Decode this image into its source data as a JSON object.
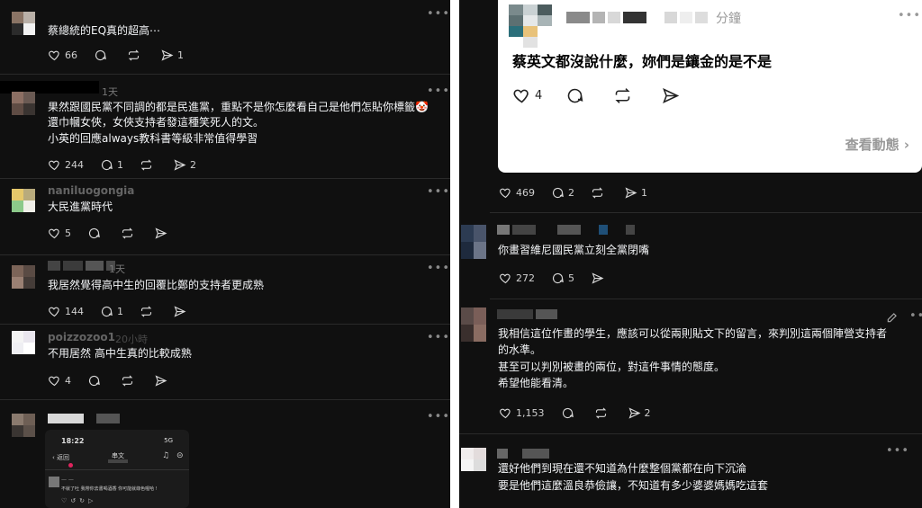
{
  "left_column": {
    "posts": [
      {
        "time": "",
        "lines": [
          "蔡總統的EQ真的超高⋯"
        ],
        "likes": "66",
        "replies": "",
        "shares": ""
      },
      {
        "time": "1天",
        "lines": [
          "果然跟國民黨不同調的都是民進黨，重點不是你怎麼看自己是他們怎貼你標籤🤡",
          "還巾幗女俠，女俠支持者發這種笑死人的文。",
          "小英的回應always教科書等級非常值得學習"
        ],
        "likes": "244",
        "replies": "1",
        "shares": "2"
      },
      {
        "time": "",
        "name_fragment": "naniluogongia",
        "lines": [
          "大民進黨時代"
        ],
        "likes": "5",
        "replies": "",
        "shares": ""
      },
      {
        "time": "1天",
        "lines": [
          "我居然覺得高中生的回覆比鄭的支持者更成熟"
        ],
        "likes": "144",
        "replies": "1",
        "shares": ""
      },
      {
        "time": "20小時",
        "name_fragment": "poizzozoo1",
        "lines": [
          "不用居然 高中生真的比較成熟"
        ],
        "likes": "4",
        "replies": "",
        "shares": ""
      }
    ],
    "phone": {
      "clock": "18:22",
      "signal": "5G",
      "back": "返回",
      "title": "串文",
      "comment": "不就了吐 我帶你去書喝酒香 你可能就綠色喔哈 !"
    }
  },
  "right_column": {
    "card": {
      "time": "分鐘",
      "text": "蔡英文都沒說什麼，妳們是鑲金的是不是",
      "likes": "4",
      "link": "查看動態"
    },
    "stats_under_card": {
      "likes": "469",
      "replies": "2",
      "shares": "1"
    },
    "posts": [
      {
        "lines": [
          "你畫習維尼國民黨立刻全黨閉嘴"
        ],
        "likes": "272",
        "replies": "5",
        "shares": ""
      },
      {
        "lines": [
          "我相信這位作畫的學生，應該可以從兩則貼文下的留言，來判別這兩個陣營支持者",
          "的水準。",
          "甚至可以判別被畫的兩位，對這件事情的態度。",
          "希望他能看清。"
        ],
        "likes": "1,153",
        "replies": "",
        "shares": "2"
      },
      {
        "lines": [
          "還好他們到現在還不知道為什麼整個黨都在向下沉淪",
          "要是他們這麼溫良恭儉讓，不知道有多少婆婆媽媽吃這套"
        ],
        "likes": "",
        "replies": "",
        "shares": ""
      }
    ]
  },
  "icons": {
    "like": "heart-icon",
    "reply": "comment-icon",
    "repost": "repost-icon",
    "share": "send-icon",
    "more": "more-icon",
    "edit": "pencil-icon"
  },
  "colors": {
    "background": "#101010",
    "text": "#f3f5f7",
    "muted": "#777777",
    "card_background": "#ffffff"
  }
}
